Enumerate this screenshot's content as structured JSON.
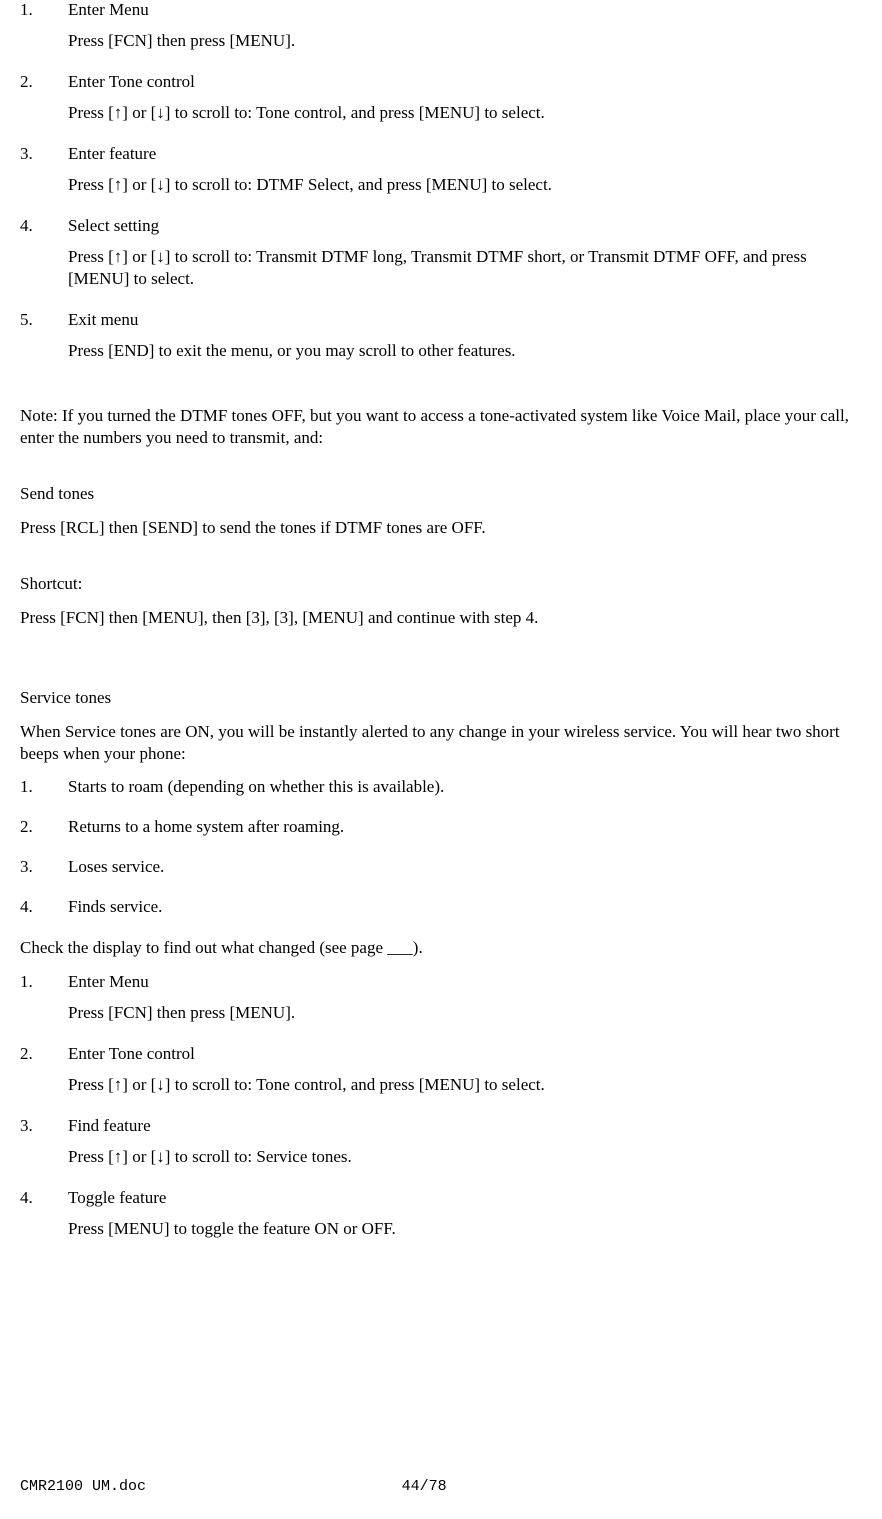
{
  "section1": {
    "steps": [
      {
        "num": "1.",
        "title": "Enter Menu",
        "detail": "Press [FCN] then press [MENU]."
      },
      {
        "num": "2.",
        "title": "Enter Tone control",
        "detail": "Press [↑] or [↓] to scroll to: Tone control, and press [MENU] to select."
      },
      {
        "num": "3.",
        "title": "Enter feature",
        "detail": "Press [↑] or [↓] to scroll to: DTMF Select, and press [MENU] to select."
      },
      {
        "num": "4.",
        "title": "Select setting",
        "detail": "Press [↑] or [↓] to scroll to: Transmit DTMF long, Transmit DTMF short, or Transmit DTMF OFF, and press [MENU] to select."
      },
      {
        "num": "5.",
        "title": "Exit menu",
        "detail": "Press [END] to exit the menu, or you may scroll to other features."
      }
    ]
  },
  "note": "Note:  If you turned the DTMF tones OFF, but you want to access a tone-activated system like Voice Mail, place your call, enter the numbers you need to transmit, and:",
  "send_tones_title": "Send tones",
  "send_tones_detail": "Press [RCL] then [SEND] to send the tones if DTMF tones are OFF.",
  "shortcut_title": "Shortcut:",
  "shortcut_detail": "Press [FCN] then [MENU], then [3], [3], [MENU] and continue with step 4.",
  "service_tones_title": "Service tones",
  "service_tones_intro": "When Service tones are ON, you will be instantly alerted to any change in your wireless service.  You will hear two short beeps when your phone:",
  "service_events": [
    {
      "num": "1.",
      "text": "Starts to roam (depending on whether this is available)."
    },
    {
      "num": "2.",
      "text": "Returns to a home system after roaming."
    },
    {
      "num": "3.",
      "text": "Loses service."
    },
    {
      "num": "4.",
      "text": "Finds service."
    }
  ],
  "check_display": "Check the display to find out what changed (see page ___).",
  "section2": {
    "steps": [
      {
        "num": "1.",
        "title": "Enter Menu",
        "detail": "Press [FCN] then press [MENU]."
      },
      {
        "num": "2.",
        "title": "Enter Tone control",
        "detail": "Press [↑] or [↓] to scroll to: Tone control, and press [MENU] to select."
      },
      {
        "num": "3.",
        "title": "Find feature",
        "detail": "Press [↑] or [↓] to scroll to: Service tones."
      },
      {
        "num": "4.",
        "title": "Toggle feature",
        "detail": "Press [MENU] to toggle the feature ON or OFF."
      }
    ]
  },
  "footer": {
    "filename": "CMR2100 UM.doc",
    "page": "44/78"
  }
}
